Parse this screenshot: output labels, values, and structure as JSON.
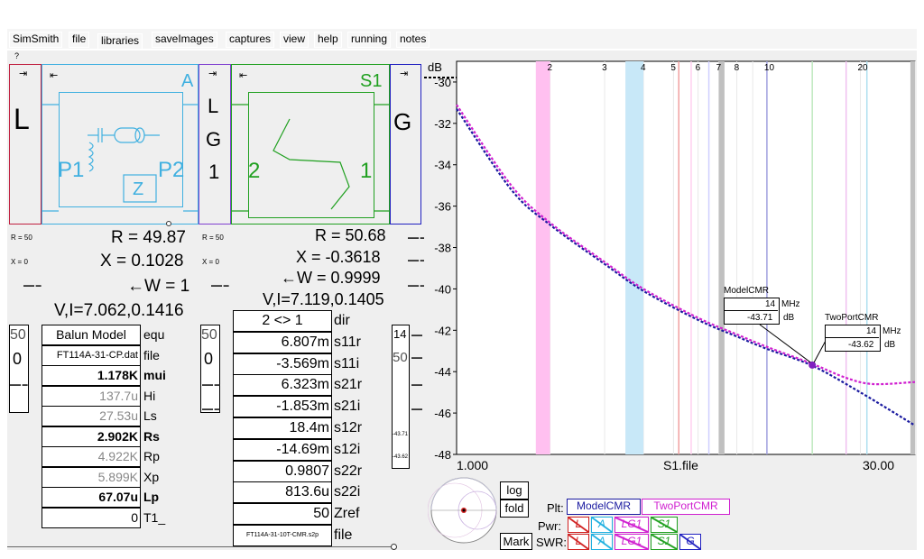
{
  "menu": {
    "items": [
      "SimSmith",
      "file",
      "libraries",
      "saveImages",
      "captures",
      "view",
      "help",
      "running",
      "notes"
    ],
    "help_mark": "?"
  },
  "circuit": {
    "load_label": "L",
    "block_a_label": "A",
    "port1": "P1",
    "port2": "P2",
    "z_symbol": "Z",
    "line_block": [
      "L",
      "G",
      "1"
    ],
    "s1_label": "S1",
    "s1_port2": "2",
    "s1_port1": "1",
    "gen_label": "G"
  },
  "left_readout": {
    "R": "R = 49.87",
    "X": "X = 0.1028",
    "W": "←W = 1",
    "VI": "V,I=7.062,0.1416",
    "r_small": "R = 50",
    "x_small": "X = 0",
    "r_small2": "R = 50",
    "x_small2": "X = 0"
  },
  "right_readout": {
    "R": "R = 50.68",
    "X": "X = -0.3618",
    "W": "←W = 0.9999",
    "VI": "V,I=7.119,0.1405"
  },
  "balun_table": {
    "rows": [
      {
        "value": "Balun Model",
        "label": "equ",
        "bold": false,
        "gray": false
      },
      {
        "value": "FT114A-31-CP.dat",
        "label": "file",
        "bold": false,
        "gray": false
      },
      {
        "value": "1.178K",
        "label": "mui",
        "bold": true,
        "gray": false
      },
      {
        "value": "137.7u",
        "label": "Hi",
        "bold": false,
        "gray": true
      },
      {
        "value": "27.53u",
        "label": "Ls",
        "bold": false,
        "gray": true
      },
      {
        "value": "2.902K",
        "label": "Rs",
        "bold": true,
        "gray": false
      },
      {
        "value": "4.922K",
        "label": "Rp",
        "bold": false,
        "gray": true
      },
      {
        "value": "5.899K",
        "label": "Xp",
        "bold": false,
        "gray": true
      },
      {
        "value": "67.07u",
        "label": "Lp",
        "bold": true,
        "gray": false
      },
      {
        "value": "0",
        "label": "T1_",
        "bold": false,
        "gray": false
      }
    ]
  },
  "sparam_table": {
    "rows": [
      {
        "value": "2 <> 1",
        "label": "dir"
      },
      {
        "value": "6.807m",
        "label": "s11r"
      },
      {
        "value": "-3.569m",
        "label": "s11i"
      },
      {
        "value": "6.323m",
        "label": "s21r"
      },
      {
        "value": "-1.853m",
        "label": "s21i"
      },
      {
        "value": "18.4m",
        "label": "s12r"
      },
      {
        "value": "-14.69m",
        "label": "s12i"
      },
      {
        "value": "0.9807",
        "label": "s22r"
      },
      {
        "value": "813.6u",
        "label": "s22i"
      },
      {
        "value": "50",
        "label": "Zref"
      },
      {
        "value": "FT114A-31-10T-CMR.s2p",
        "label": "file"
      }
    ]
  },
  "side_boxes": {
    "left_a": [
      "50",
      "0"
    ],
    "left_b": [
      "50",
      "0"
    ],
    "right": [
      "14",
      "50",
      "",
      "",
      "-43.71",
      "-43.62"
    ]
  },
  "chart": {
    "y_unit": "dB",
    "x_left": "1.000",
    "x_center": "S1.file",
    "x_right": "30.00",
    "top_ticks": [
      "2",
      "3",
      "4",
      "5",
      "6",
      "7",
      "8",
      "10",
      "20"
    ],
    "y_ticks": [
      "-30",
      "-32",
      "-34",
      "-36",
      "-38",
      "-40",
      "-42",
      "-44",
      "-46",
      "-48"
    ],
    "marker1": {
      "title": "ModelCMR",
      "freq": "14",
      "freq_unit": "MHz",
      "db": "-43.71",
      "db_unit": "dB"
    },
    "marker2": {
      "title": "TwoPortCMR",
      "freq": "14",
      "freq_unit": "MHz",
      "db": "-43.62",
      "db_unit": "dB"
    }
  },
  "chart_data": {
    "type": "line",
    "xlabel": "S1.file",
    "ylabel": "dB",
    "xscale": "log",
    "xlim": [
      1,
      30
    ],
    "ylim": [
      -48,
      -29
    ],
    "series": [
      {
        "name": "ModelCMR",
        "color": "#1a1aa0",
        "x": [
          1.0,
          1.5,
          2.0,
          3.0,
          4.0,
          6.0,
          8.0,
          10.0,
          14.0,
          20.0,
          30.0
        ],
        "y": [
          -31.3,
          -35.2,
          -36.9,
          -38.8,
          -40.1,
          -41.5,
          -42.3,
          -42.9,
          -43.71,
          -45.0,
          -46.6
        ]
      },
      {
        "name": "TwoPortCMR",
        "color": "#d020d0",
        "x": [
          1.0,
          1.5,
          2.0,
          3.0,
          4.0,
          6.0,
          8.0,
          10.0,
          14.0,
          18.0,
          22.0,
          30.0
        ],
        "y": [
          -31.1,
          -35.0,
          -36.8,
          -38.7,
          -40.0,
          -41.4,
          -42.2,
          -42.8,
          -43.62,
          -44.3,
          -44.6,
          -44.5
        ]
      }
    ],
    "bands": [
      {
        "x": [
          1.8,
          2.0
        ],
        "color": "#ffc0f0"
      },
      {
        "x": [
          3.5,
          4.0
        ],
        "color": "#c8e8f8"
      },
      {
        "x": [
          7.0,
          7.3
        ],
        "color": "#c0c0c0"
      },
      {
        "x": [
          29.0,
          30.0
        ],
        "color": "#c0c0c0"
      }
    ],
    "vlines": [
      {
        "x": 5.2,
        "color": "#f0a0a0"
      },
      {
        "x": 5.7,
        "color": "#ffd0f0"
      },
      {
        "x": 6.5,
        "color": "#d0d0ff"
      },
      {
        "x": 14.0,
        "color": "#c0e8c0"
      },
      {
        "x": 10.0,
        "color": "#a0a0e0"
      },
      {
        "x": 18.0,
        "color": "#f0c0f0"
      },
      {
        "x": 21.0,
        "color": "#b0e0f0"
      }
    ]
  },
  "controls": {
    "log": "log",
    "fold": "fold",
    "mark": "Mark",
    "plt_label": "Plt:",
    "pwr_label": "Pwr:",
    "swr_label": "SWR:",
    "plt_model": "ModelCMR",
    "plt_twoport": "TwoPortCMR",
    "pwr_buttons": [
      "L",
      "A",
      "LG1",
      "S1"
    ],
    "swr_buttons": [
      "L",
      "A",
      "LG1",
      "S1",
      "G"
    ]
  },
  "colors": {
    "load": "#c02040",
    "blockA": "#40b0e0",
    "lineBlock": "#8040d0",
    "s1": "#20a020",
    "gen": "#2020c0",
    "model": "#1a1aa0",
    "twoport": "#d020d0"
  }
}
